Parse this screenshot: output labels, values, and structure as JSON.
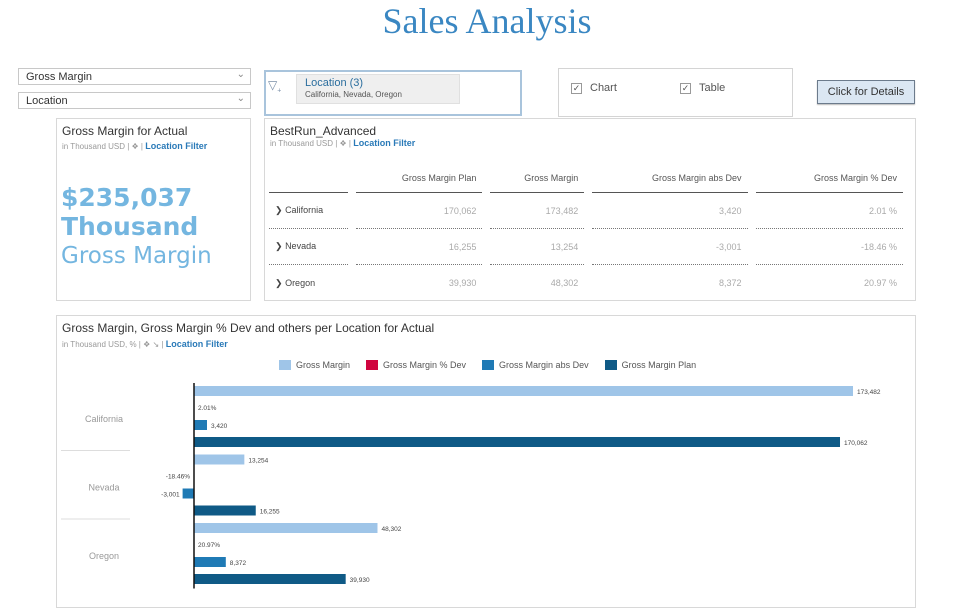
{
  "title": "Sales Analysis",
  "dropdowns": [
    {
      "value": "Gross Margin"
    },
    {
      "value": "Location"
    }
  ],
  "filter": {
    "label": "Location (3)",
    "values": "California, Nevada, Oregon"
  },
  "checkboxes": [
    {
      "label": "Chart",
      "checked": true
    },
    {
      "label": "Table",
      "checked": true
    }
  ],
  "details_button": "Click for Details",
  "kpi_card": {
    "title": "Gross Margin for Actual",
    "unit": "in Thousand USD",
    "link": "Location Filter",
    "value": "$235,037",
    "scale": "Thousand",
    "measure": "Gross Margin",
    "color": "#74b6e0"
  },
  "table_card": {
    "title": "BestRun_Advanced",
    "unit": "in Thousand USD",
    "link": "Location Filter",
    "columns": [
      "",
      "Gross Margin Plan",
      "Gross Margin",
      "Gross Margin abs Dev",
      "Gross Margin % Dev"
    ],
    "rows": [
      {
        "location": "California",
        "plan": "170,062",
        "gm": "173,482",
        "abs": "3,420",
        "pct": "2.01 %"
      },
      {
        "location": "Nevada",
        "plan": "16,255",
        "gm": "13,254",
        "abs": "-3,001",
        "pct": "-18.46 %"
      },
      {
        "location": "Oregon",
        "plan": "39,930",
        "gm": "48,302",
        "abs": "8,372",
        "pct": "20.97 %"
      }
    ]
  },
  "chart_card": {
    "title": "Gross Margin, Gross Margin % Dev and others per Location for Actual",
    "unit": "in Thousand USD, %",
    "link": "Location Filter"
  },
  "chart_data": {
    "type": "bar",
    "orientation": "horizontal",
    "title": "Gross Margin, Gross Margin % Dev and others per Location for Actual",
    "categories": [
      "California",
      "Nevada",
      "Oregon"
    ],
    "legend_position": "top",
    "series": [
      {
        "name": "Gross Margin",
        "color": "#9fc5e8",
        "values": [
          173482,
          13254,
          48302
        ],
        "labels": [
          "173,482",
          "13,254",
          "48,302"
        ]
      },
      {
        "name": "Gross Margin % Dev",
        "color": "#d0053f",
        "values": [
          2.01,
          -18.46,
          20.97
        ],
        "labels": [
          "2.01%",
          "-18.46%",
          "20.97%"
        ]
      },
      {
        "name": "Gross Margin abs Dev",
        "color": "#1f7ab5",
        "values": [
          3420,
          -3001,
          8372
        ],
        "labels": [
          "3,420",
          "-3,001",
          "8,372"
        ]
      },
      {
        "name": "Gross Margin Plan",
        "color": "#0f5a86",
        "values": [
          170062,
          16255,
          39930
        ],
        "labels": [
          "170,062",
          "16,255",
          "39,930"
        ]
      }
    ],
    "xlim": [
      -10000,
      180000
    ],
    "grid": false
  }
}
